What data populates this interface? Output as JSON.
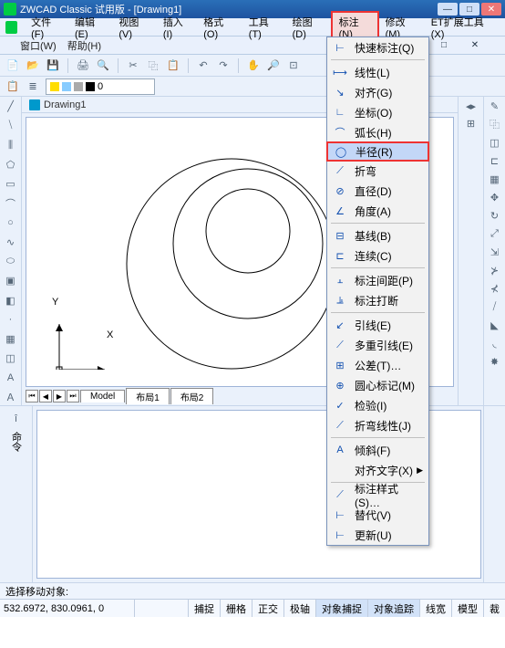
{
  "title": "ZWCAD Classic 试用版 - [Drawing1]",
  "menubar": {
    "file": "文件(F)",
    "edit": "编辑(E)",
    "view": "视图(V)",
    "insert": "插入(I)",
    "format": "格式(O)",
    "tools": "工具(T)",
    "draw": "绘图(D)",
    "dim": "标注(N)",
    "modify": "修改(M)",
    "et": "ET扩展工具(X)",
    "window": "窗口(W)",
    "help": "帮助(H)"
  },
  "doc_name": "Drawing1",
  "layer_combo": "0",
  "tabs": {
    "model": "Model",
    "layout1": "布局1",
    "layout2": "布局2"
  },
  "ucs": {
    "x": "X",
    "y": "Y"
  },
  "dropdown": [
    {
      "icon": "⊢",
      "label": "快速标注(Q)"
    },
    {
      "sep": true
    },
    {
      "icon": "⟼",
      "label": "线性(L)"
    },
    {
      "icon": "↘",
      "label": "对齐(G)"
    },
    {
      "icon": "∟",
      "label": "坐标(O)"
    },
    {
      "icon": "⌒",
      "label": "弧长(H)"
    },
    {
      "icon": "◯",
      "label": "半径(R)",
      "selected": true
    },
    {
      "icon": "⟋",
      "label": "折弯"
    },
    {
      "icon": "⊘",
      "label": "直径(D)"
    },
    {
      "icon": "∠",
      "label": "角度(A)"
    },
    {
      "sep": true
    },
    {
      "icon": "⊟",
      "label": "基线(B)"
    },
    {
      "icon": "⊏",
      "label": "连续(C)"
    },
    {
      "sep": true
    },
    {
      "icon": "⫠",
      "label": "标注间距(P)"
    },
    {
      "icon": "⫡",
      "label": "标注打断"
    },
    {
      "sep": true
    },
    {
      "icon": "↙",
      "label": "引线(E)"
    },
    {
      "icon": "⟋",
      "label": "多重引线(E)"
    },
    {
      "icon": "⊞",
      "label": "公差(T)…"
    },
    {
      "icon": "⊕",
      "label": "圆心标记(M)"
    },
    {
      "icon": "✓",
      "label": "检验(I)"
    },
    {
      "icon": "⟋",
      "label": "折弯线性(J)"
    },
    {
      "sep": true
    },
    {
      "icon": "A",
      "label": "倾斜(F)"
    },
    {
      "icon": " ",
      "label": "对齐文字(X)",
      "arrow": true
    },
    {
      "sep": true
    },
    {
      "icon": "⟋",
      "label": "标注样式(S)…"
    },
    {
      "icon": "⊢",
      "label": "替代(V)"
    },
    {
      "icon": "⊢",
      "label": "更新(U)"
    }
  ],
  "cmd_prompt": "选择移动对象:",
  "coords": "532.6972, 830.0961, 0",
  "status": {
    "snap": "捕捉",
    "grid": "栅格",
    "ortho": "正交",
    "polar": "极轴",
    "osnap": "对象捕捉",
    "otrack": "对象追踪",
    "lw": "线宽",
    "model": "模型",
    "cy": "裁"
  }
}
